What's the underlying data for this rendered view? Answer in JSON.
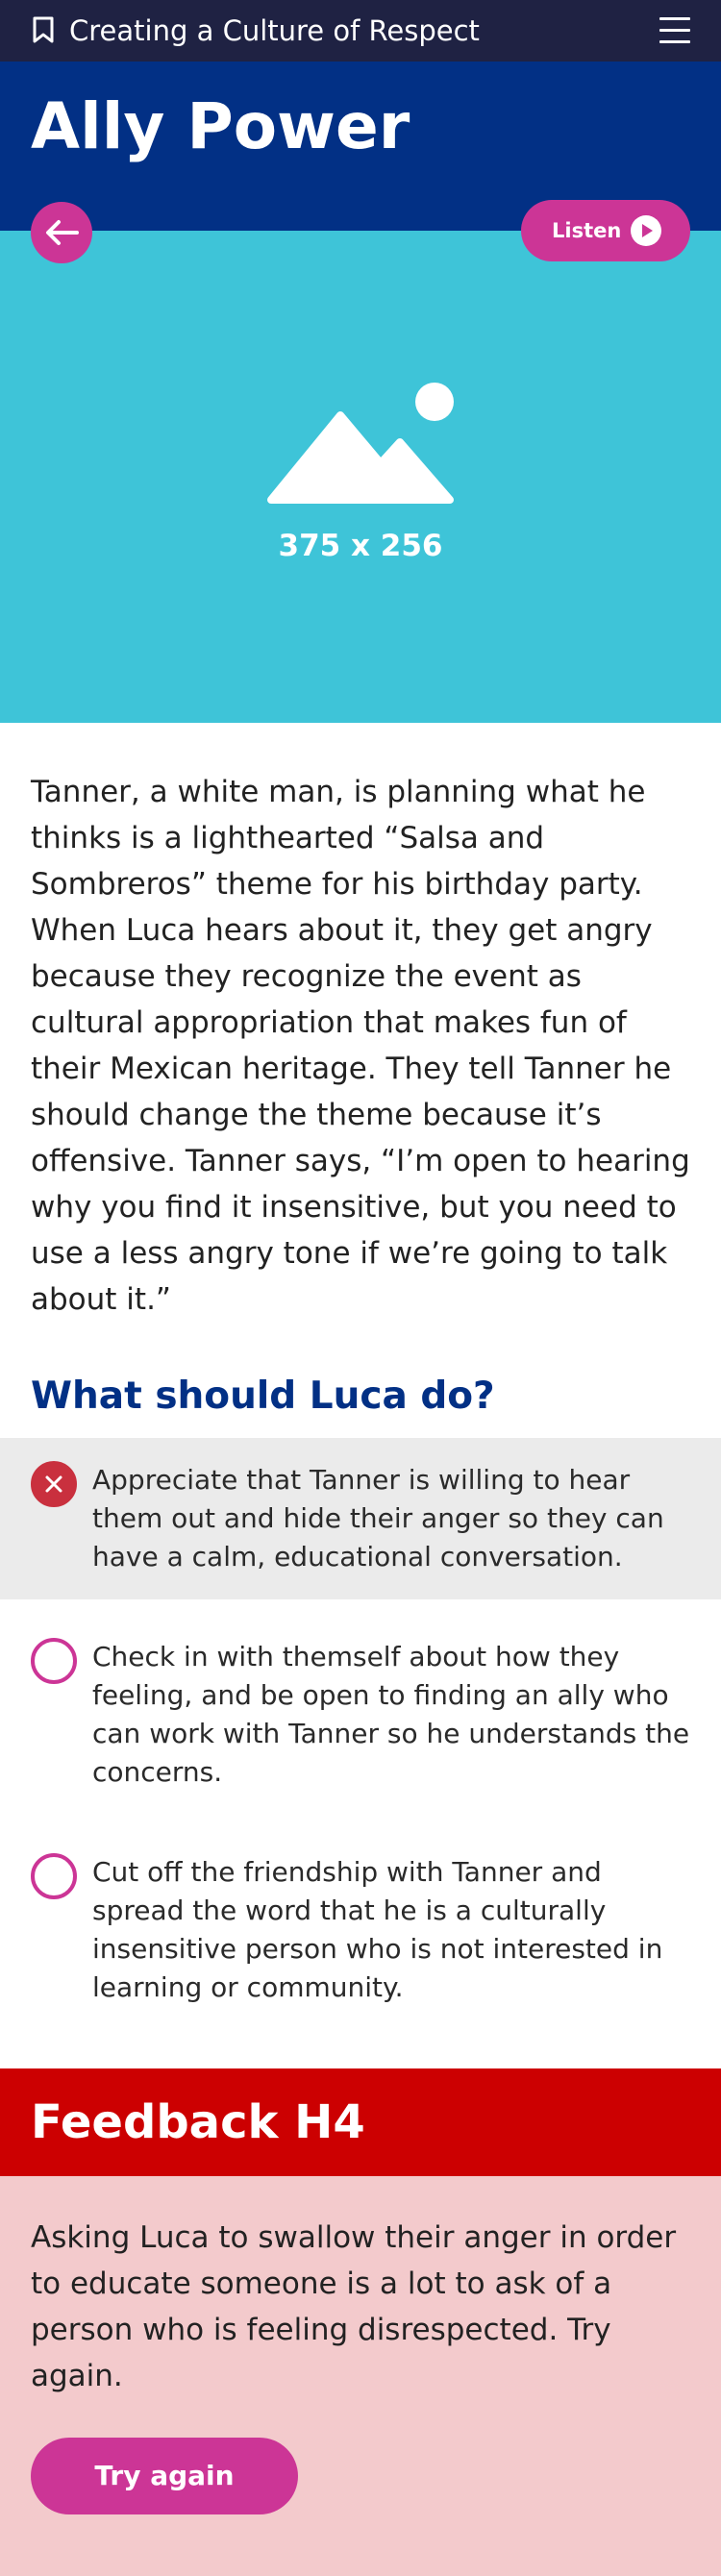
{
  "topbar": {
    "app_title": "Creating a Culture of Respect",
    "bookmark_icon": "bookmark-icon",
    "menu_icon": "hamburger-menu-icon"
  },
  "header": {
    "title": "Ally Power"
  },
  "controls": {
    "back_icon": "arrow-left-icon",
    "listen_label": "Listen",
    "play_icon": "play-circle-icon"
  },
  "hero": {
    "placeholder_icon": "image-placeholder-icon",
    "dimensions": "375 x 256"
  },
  "story": {
    "text": "Tanner, a white man, is planning what he thinks is a lighthearted “Salsa and Sombreros” theme for his birthday party. When Luca hears about it, they get angry because they recognize the event as cultural appropriation that makes fun of their Mexican heritage. They tell Tanner he should change the theme because it’s offensive. Tanner says, “I’m open to hearing why you find it insensitive, but you need to use a less angry tone if we’re going to talk about it.”"
  },
  "question": {
    "title": "What should Luca do?",
    "options": [
      {
        "label": "Appreciate that Tanner is willing to hear them out and hide their anger so they can have a calm, educational conversation.",
        "state": "selected-incorrect"
      },
      {
        "label": "Check in with themself about how they feeling, and be open to finding an ally who can work with Tanner so he understands the concerns.",
        "state": "unselected"
      },
      {
        "label": "Cut off the friendship with Tanner and spread the word that he is a culturally insensitive person who is not interested in learning or community.",
        "state": "unselected"
      }
    ]
  },
  "feedback": {
    "title": "Feedback H4",
    "text": "Asking Luca to swallow their anger in order to educate someone is a lot to ask of a person who is feeling disrespected. Try again.",
    "button_label": "Try again"
  },
  "colors": {
    "topbar_bg": "#1f2243",
    "header_bg": "#023085",
    "accent_magenta": "#cc3596",
    "hero_bg": "#3ec4d8",
    "question_blue": "#023085",
    "wrong_red": "#c9303e",
    "feedback_header_bg": "#cc0001",
    "feedback_body_bg": "#f3cacc",
    "selected_bg": "#ebebeb"
  }
}
